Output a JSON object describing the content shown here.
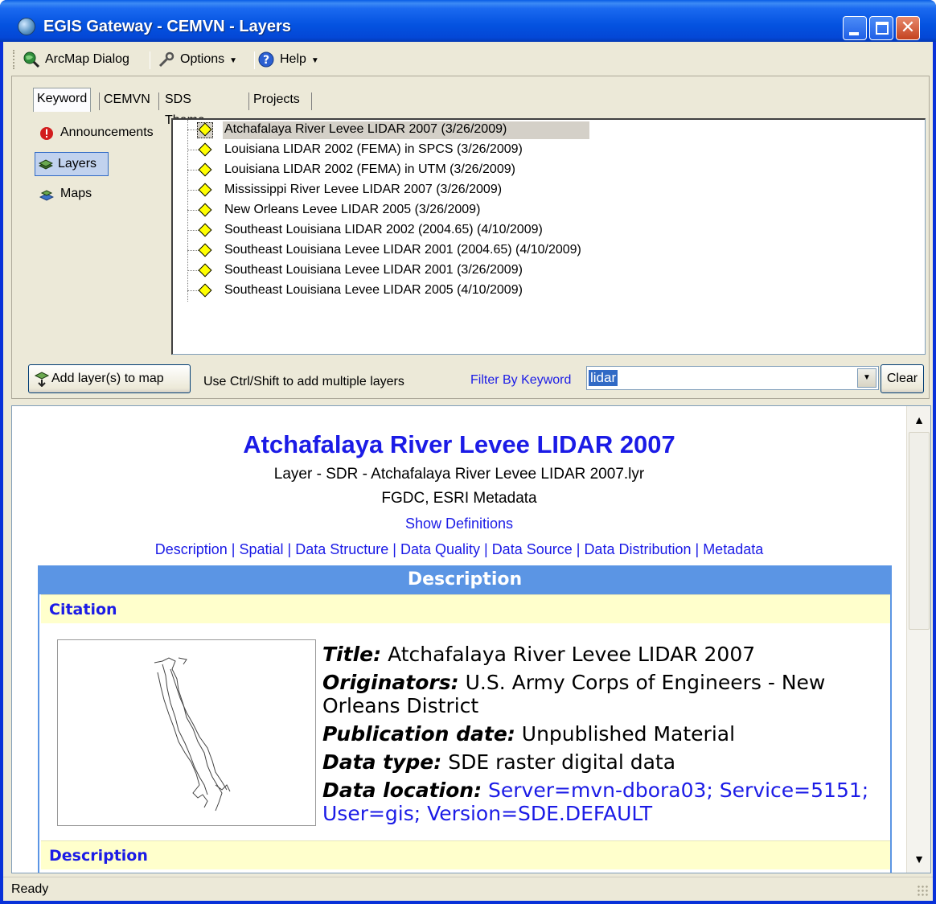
{
  "window": {
    "title": "EGIS Gateway - CEMVN - Layers"
  },
  "menu": [
    {
      "label": "ArcMap Dialog",
      "icon": "globe-search-icon"
    },
    {
      "label": "Options",
      "icon": "tools-icon"
    },
    {
      "label": "Help",
      "icon": "help-icon"
    }
  ],
  "tabs": [
    "Keyword",
    "CEMVN",
    "SDS Theme",
    "Projects"
  ],
  "sidebar": [
    {
      "label": "Announcements",
      "icon": "alert-icon"
    },
    {
      "label": "Layers",
      "icon": "layers-icon"
    },
    {
      "label": "Maps",
      "icon": "maps-icon"
    }
  ],
  "layers": [
    "Atchafalaya River Levee LIDAR 2007 (3/26/2009)",
    "Louisiana LIDAR 2002 (FEMA) in SPCS (3/26/2009)",
    "Louisiana LIDAR 2002 (FEMA) in UTM (3/26/2009)",
    "Mississippi River Levee LIDAR 2007 (3/26/2009)",
    "New Orleans Levee LIDAR 2005 (3/26/2009)",
    "Southeast Louisiana LIDAR 2002 (2004.65) (4/10/2009)",
    "Southeast Louisiana Levee LIDAR 2001 (2004.65) (4/10/2009)",
    "Southeast Louisiana Levee LIDAR 2001 (3/26/2009)",
    "Southeast Louisiana Levee LIDAR 2005 (4/10/2009)"
  ],
  "toolbar": {
    "add_button": "Add layer(s) to map",
    "hint": "Use Ctrl/Shift to add multiple layers",
    "filter_label": "Filter By Keyword",
    "filter_value": "lidar",
    "clear_button": "Clear"
  },
  "doc": {
    "title": "Atchafalaya River Levee LIDAR 2007",
    "subtitle": "Layer - SDR - Atchafalaya River Levee LIDAR 2007.lyr",
    "metadata_types": "FGDC, ESRI Metadata",
    "show_definitions": "Show Definitions",
    "nav_links": [
      "Description",
      "Spatial",
      "Data Structure",
      "Data Quality",
      "Data Source",
      "Data Distribution",
      "Metadata"
    ],
    "section_header": "Description",
    "citation_label": "Citation",
    "description_label": "Description",
    "fields": {
      "title_key": "Title:",
      "title_val": "Atchafalaya River Levee LIDAR 2007",
      "orig_key": "Originators:",
      "orig_val": "U.S. Army Corps of Engineers - New Orleans District",
      "pub_key": "Publication date:",
      "pub_val": "Unpublished Material",
      "type_key": "Data type:",
      "type_val": "SDE raster digital data",
      "loc_key": "Data location:",
      "loc_val": "Server=mvn-dbora03; Service=5151; User=gis; Version=SDE.DEFAULT"
    }
  },
  "status": "Ready",
  "colors": {
    "title_blue": "#0452e0",
    "link_blue": "#1b1be6",
    "header_blue": "#5b95e4",
    "section_yellow": "#ffffcc"
  }
}
